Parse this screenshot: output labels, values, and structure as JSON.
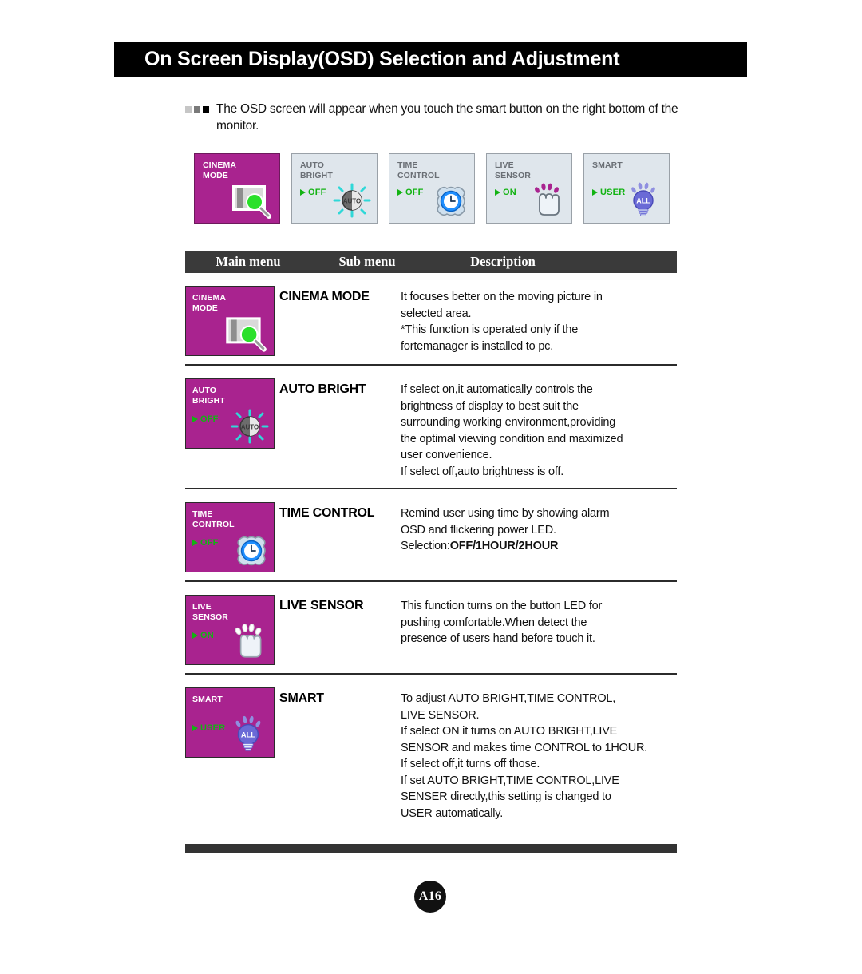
{
  "header": {
    "title": "On Screen Display(OSD) Selection and Adjustment"
  },
  "intro": {
    "text": "The OSD screen will appear when you touch the smart button on the right bottom of the monitor.",
    "bullet_icons": [
      "square-light-icon",
      "square-mid-icon",
      "square-dark-icon"
    ]
  },
  "osd_buttons": [
    {
      "label_line1": "CINEMA",
      "label_line2": "MODE",
      "value": "",
      "active": true,
      "icon": "cinema-screen-magnifier-icon"
    },
    {
      "label_line1": "AUTO",
      "label_line2": "BRIGHT",
      "value": "OFF",
      "active": false,
      "icon": "auto-brightness-icon"
    },
    {
      "label_line1": "TIME",
      "label_line2": "CONTROL",
      "value": "OFF",
      "active": false,
      "icon": "alarm-clock-icon"
    },
    {
      "label_line1": "LIVE",
      "label_line2": "SENSOR",
      "value": "ON",
      "active": false,
      "icon": "hand-touch-sensor-icon"
    },
    {
      "label_line1": "SMART",
      "label_line2": "",
      "value": "USER",
      "active": false,
      "icon": "light-bulb-all-icon"
    }
  ],
  "table": {
    "headers": {
      "main_menu": "Main menu",
      "sub_menu": "Sub menu",
      "description": "Description"
    },
    "rows": [
      {
        "tile": {
          "label_line1": "CINEMA",
          "label_line2": "MODE",
          "value": "",
          "icon": "cinema-screen-magnifier-icon"
        },
        "sub_menu": "CINEMA MODE",
        "description": [
          "It focuses better on the moving picture in",
          "selected area.",
          "*This function is operated only if the",
          "fortemanager is installed to pc."
        ]
      },
      {
        "tile": {
          "label_line1": "AUTO",
          "label_line2": "BRIGHT",
          "value": "OFF",
          "icon": "auto-brightness-icon"
        },
        "sub_menu": "AUTO BRIGHT",
        "description": [
          "If select on,it automatically controls the",
          "brightness of display to best suit the",
          "surrounding working environment,providing",
          "the optimal viewing condition and maximized",
          "user convenience.",
          "If select off,auto brightness is off."
        ]
      },
      {
        "tile": {
          "label_line1": "TIME",
          "label_line2": "CONTROL",
          "value": "OFF",
          "icon": "alarm-clock-icon"
        },
        "sub_menu": "TIME CONTROL",
        "description": [
          "Remind user using time by showing alarm",
          "OSD and flickering power LED."
        ],
        "description_bold_lead": "Selection:",
        "description_bold": "OFF/1HOUR/2HOUR"
      },
      {
        "tile": {
          "label_line1": "LIVE",
          "label_line2": "SENSOR",
          "value": "ON",
          "icon": "hand-touch-sensor-icon"
        },
        "sub_menu": "LIVE SENSOR",
        "description": [
          "This function turns on the button LED for",
          "pushing comfortable.When detect the",
          "presence of users hand before touch it."
        ]
      },
      {
        "tile": {
          "label_line1": "SMART",
          "label_line2": "",
          "value": "USER",
          "icon": "light-bulb-all-icon"
        },
        "sub_menu": "SMART",
        "description": [
          "To adjust AUTO BRIGHT,TIME CONTROL,",
          "LIVE SENSOR.",
          "If select ON it turns on AUTO BRIGHT,LIVE",
          "SENSOR and makes time CONTROL to 1HOUR.",
          "If select off,it turns off those.",
          "If set AUTO BRIGHT,TIME CONTROL,LIVE",
          "SENSER directly,this setting is changed to",
          "USER automatically."
        ]
      }
    ]
  },
  "footer": {
    "page_number": "A16"
  },
  "colors": {
    "accent_magenta": "#a9238f",
    "value_green": "#12b312",
    "header_bar": "#3a3a3a",
    "title_bar": "#000000",
    "osd_panel": "#dfe6ec"
  }
}
